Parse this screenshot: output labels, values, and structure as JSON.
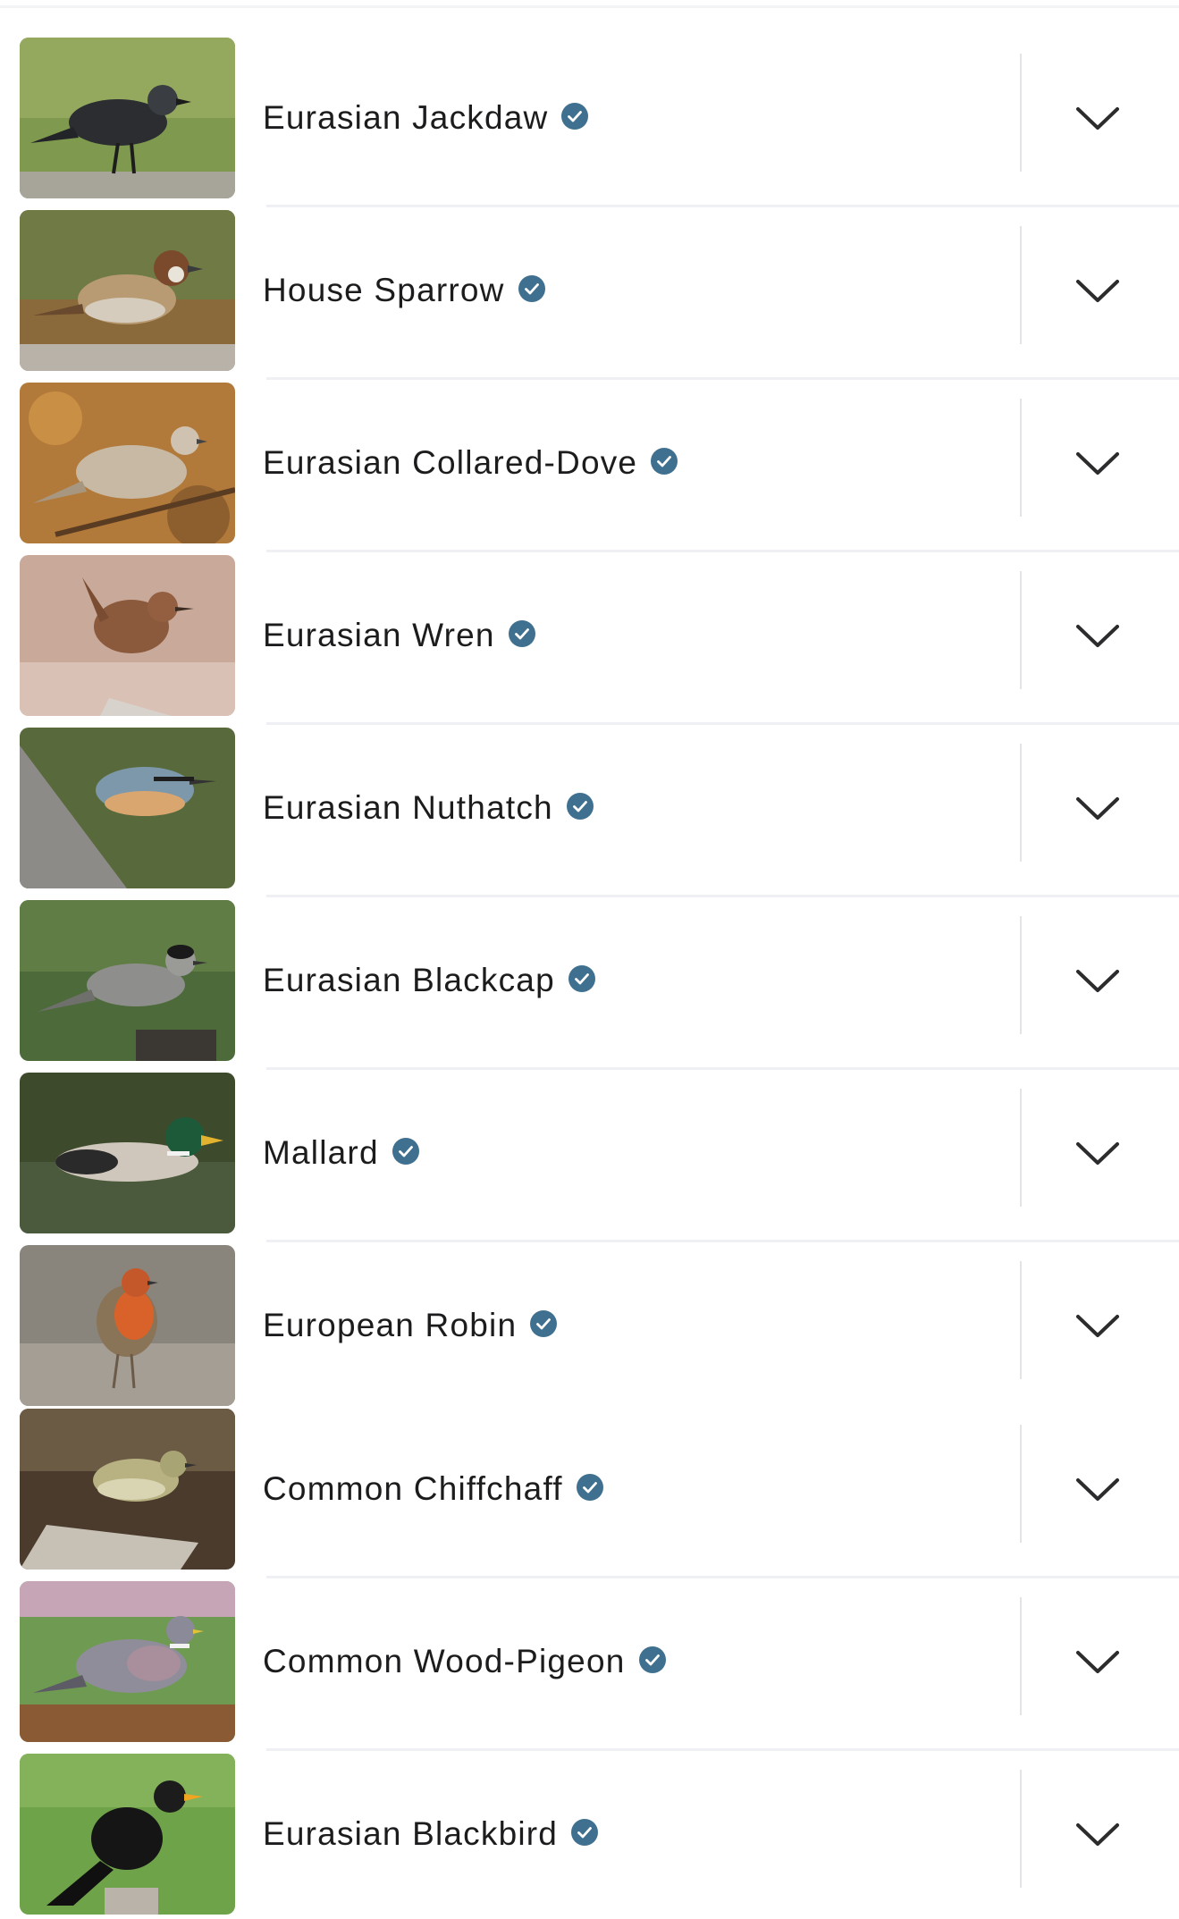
{
  "colors": {
    "verified_badge": "#40708f",
    "chevron": "#2c2c2e",
    "separator": "#e3e4e8"
  },
  "icons": {
    "verified": "verified-check-icon",
    "expand": "chevron-down-icon"
  },
  "species": [
    {
      "name": "Eurasian Jackdaw",
      "verified": true
    },
    {
      "name": "House Sparrow",
      "verified": true
    },
    {
      "name": "Eurasian Collared-Dove",
      "verified": true
    },
    {
      "name": "Eurasian Wren",
      "verified": true
    },
    {
      "name": "Eurasian Nuthatch",
      "verified": true
    },
    {
      "name": "Eurasian Blackcap",
      "verified": true
    },
    {
      "name": "Mallard",
      "verified": true
    },
    {
      "name": "European Robin",
      "verified": true
    },
    {
      "name": "Common Chiffchaff",
      "verified": true
    },
    {
      "name": "Common Wood-Pigeon",
      "verified": true
    },
    {
      "name": "Eurasian Blackbird",
      "verified": true
    }
  ]
}
